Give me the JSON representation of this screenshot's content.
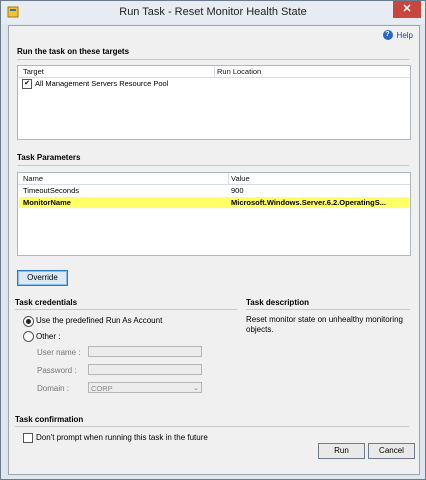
{
  "window": {
    "title": "Run Task - Reset Monitor Health State",
    "close_glyph": "✕"
  },
  "help": {
    "label": "Help",
    "icon_glyph": "?"
  },
  "targets": {
    "section_title": "Run the task on these targets",
    "columns": [
      "Target",
      "Run Location"
    ],
    "rows": [
      {
        "target": "All Management Servers Resource Pool",
        "run_location": "",
        "checked": true
      }
    ]
  },
  "parameters": {
    "section_title": "Task Parameters",
    "columns": [
      "Name",
      "Value"
    ],
    "rows": [
      {
        "name": "TimeoutSeconds",
        "value": "900"
      },
      {
        "name": "MonitorName",
        "value": "Microsoft.Windows.Server.6.2.OperatingS..."
      }
    ]
  },
  "override_button": "Override",
  "credentials": {
    "section_title": "Task credentials",
    "option_predefined": "Use the predefined Run As Account",
    "option_other": "Other :",
    "username_label": "User name :",
    "username_value": "",
    "password_label": "Password :",
    "password_value": "",
    "domain_label": "Domain :",
    "domain_value": "CORP"
  },
  "description": {
    "section_title": "Task description",
    "text": "Reset monitor state on unhealthy monitoring objects."
  },
  "confirmation": {
    "section_title": "Task confirmation",
    "checkbox_label": "Don't prompt when running this task in the future",
    "checked": false
  },
  "buttons": {
    "run": "Run",
    "cancel": "Cancel"
  },
  "colors": {
    "highlight": "#ffff66",
    "close": "#c9453f",
    "help_link": "#1a4c9c"
  }
}
